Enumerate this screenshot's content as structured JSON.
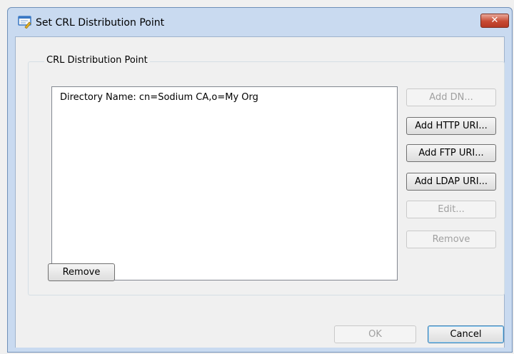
{
  "dialog": {
    "title": "Set CRL Distribution Point",
    "close_glyph": "✕"
  },
  "group": {
    "label": "CRL Distribution Point"
  },
  "list": {
    "items": [
      "Directory Name: cn=Sodium CA,o=My Org"
    ]
  },
  "side_buttons": {
    "add_dn": "Add DN...",
    "add_http_uri": "Add HTTP URI...",
    "add_ftp_uri": "Add FTP URI...",
    "add_ldap_uri": "Add LDAP URI...",
    "edit": "Edit...",
    "remove": "Remove"
  },
  "remove_button": "Remove",
  "footer": {
    "ok": "OK",
    "cancel": "Cancel"
  },
  "colors": {
    "title_bar": "#c9daf0",
    "close_button": "#c74a33",
    "disabled_text": "#a0a0a0"
  }
}
